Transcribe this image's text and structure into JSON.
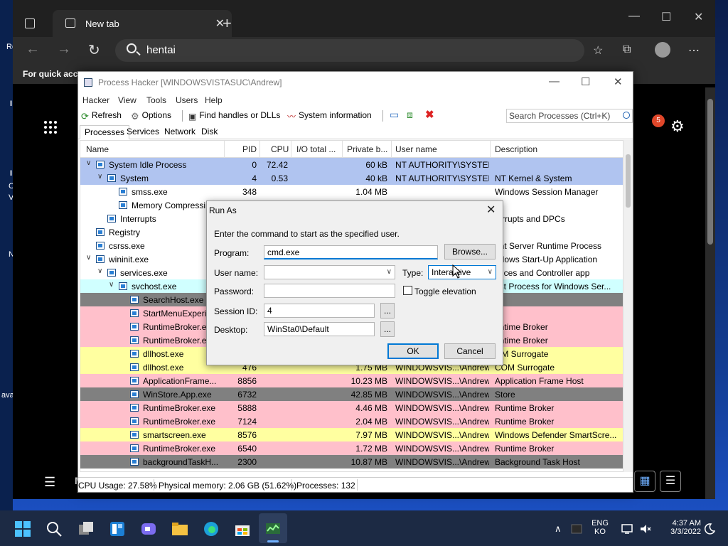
{
  "desktop": {
    "fragments": [
      "Re",
      "I",
      "I",
      "C",
      "V",
      "N",
      "ava"
    ]
  },
  "browser": {
    "tab_title": "New tab",
    "search_query": "hentai",
    "info_bar_text": "For quick acc",
    "notification_count": "5"
  },
  "ph": {
    "title": "Process Hacker [WINDOWSVISTASUC\\Andrew]",
    "menu": [
      "Hacker",
      "View",
      "Tools",
      "Users",
      "Help"
    ],
    "toolbar": {
      "refresh": "Refresh",
      "options": "Options",
      "find_handles": "Find handles or DLLs",
      "system_info": "System information",
      "search_placeholder": "Search Processes (Ctrl+K)"
    },
    "tabs": [
      "Processes",
      "Services",
      "Network",
      "Disk"
    ],
    "columns": [
      "Name",
      "PID",
      "CPU",
      "I/O total ...",
      "Private b...",
      "User name",
      "Description"
    ],
    "rows": [
      {
        "indent": 0,
        "twisty": "v",
        "name": "System Idle Process",
        "pid": "0",
        "cpu": "72.42",
        "io": "",
        "priv": "60 kB",
        "user": "NT AUTHORITY\\SYSTEM",
        "desc": "",
        "bg": "#b0c4f0"
      },
      {
        "indent": 1,
        "twisty": "v",
        "name": "System",
        "pid": "4",
        "cpu": "0.53",
        "io": "",
        "priv": "40 kB",
        "user": "NT AUTHORITY\\SYSTEM",
        "desc": "NT Kernel & System",
        "bg": "#b0c4f0"
      },
      {
        "indent": 2,
        "twisty": "",
        "name": "smss.exe",
        "pid": "348",
        "cpu": "",
        "io": "",
        "priv": "1.04 MB",
        "user": "",
        "desc": "Windows Session Manager",
        "bg": "#ffffff"
      },
      {
        "indent": 2,
        "twisty": "",
        "name": "Memory Compressi",
        "pid": "",
        "cpu": "",
        "io": "",
        "priv": "",
        "user": "",
        "desc": "",
        "bg": "#ffffff"
      },
      {
        "indent": 1,
        "twisty": "",
        "name": "Interrupts",
        "pid": "",
        "cpu": "",
        "io": "",
        "priv": "",
        "user": "",
        "desc": "terrupts and DPCs",
        "bg": "#ffffff"
      },
      {
        "indent": 0,
        "twisty": "",
        "name": "Registry",
        "pid": "",
        "cpu": "",
        "io": "",
        "priv": "",
        "user": "",
        "desc": "",
        "bg": "#ffffff"
      },
      {
        "indent": 0,
        "twisty": "",
        "name": "csrss.exe",
        "pid": "",
        "cpu": "",
        "io": "",
        "priv": "",
        "user": "",
        "desc": "ent Server Runtime Process",
        "bg": "#ffffff"
      },
      {
        "indent": 0,
        "twisty": "v",
        "name": "wininit.exe",
        "pid": "",
        "cpu": "",
        "io": "",
        "priv": "",
        "user": "",
        "desc": "ndows Start-Up Application",
        "bg": "#ffffff"
      },
      {
        "indent": 1,
        "twisty": "v",
        "name": "services.exe",
        "pid": "",
        "cpu": "",
        "io": "",
        "priv": "",
        "user": "",
        "desc": "rvices and Controller app",
        "bg": "#ffffff"
      },
      {
        "indent": 2,
        "twisty": "v",
        "name": "svchost.exe",
        "pid": "",
        "cpu": "",
        "io": "",
        "priv": "",
        "user": "",
        "desc": "ost Process for Windows Ser...",
        "bg": "#d0ffff"
      },
      {
        "indent": 3,
        "twisty": "",
        "name": "SearchHost.exe",
        "pid": "",
        "cpu": "",
        "io": "",
        "priv": "",
        "user": "",
        "desc": "",
        "bg": "#808080"
      },
      {
        "indent": 3,
        "twisty": "",
        "name": "StartMenuExperi",
        "pid": "",
        "cpu": "",
        "io": "",
        "priv": "",
        "user": "",
        "desc": "",
        "bg": "#ffc0cb"
      },
      {
        "indent": 3,
        "twisty": "",
        "name": "RuntimeBroker.e",
        "pid": "",
        "cpu": "",
        "io": "",
        "priv": "",
        "user": "",
        "desc": "untime Broker",
        "bg": "#ffc0cb"
      },
      {
        "indent": 3,
        "twisty": "",
        "name": "RuntimeBroker.e",
        "pid": "",
        "cpu": "",
        "io": "",
        "priv": "",
        "user": "",
        "desc": "untime Broker",
        "bg": "#ffc0cb"
      },
      {
        "indent": 3,
        "twisty": "",
        "name": "dllhost.exe",
        "pid": "",
        "cpu": "",
        "io": "",
        "priv": "",
        "user": "",
        "desc": "OM Surrogate",
        "bg": "#ffffa0"
      },
      {
        "indent": 3,
        "twisty": "",
        "name": "dllhost.exe",
        "pid": "476",
        "cpu": "",
        "io": "",
        "priv": "1.75 MB",
        "user": "WINDOWSVIS...\\Andrew",
        "desc": "COM Surrogate",
        "bg": "#ffffa0"
      },
      {
        "indent": 3,
        "twisty": "",
        "name": "ApplicationFrame...",
        "pid": "8856",
        "cpu": "",
        "io": "",
        "priv": "10.23 MB",
        "user": "WINDOWSVIS...\\Andrew",
        "desc": "Application Frame Host",
        "bg": "#ffc0cb"
      },
      {
        "indent": 3,
        "twisty": "",
        "name": "WinStore.App.exe",
        "pid": "6732",
        "cpu": "",
        "io": "",
        "priv": "42.85 MB",
        "user": "WINDOWSVIS...\\Andrew",
        "desc": "Store",
        "bg": "#808080"
      },
      {
        "indent": 3,
        "twisty": "",
        "name": "RuntimeBroker.exe",
        "pid": "5888",
        "cpu": "",
        "io": "",
        "priv": "4.46 MB",
        "user": "WINDOWSVIS...\\Andrew",
        "desc": "Runtime Broker",
        "bg": "#ffc0cb"
      },
      {
        "indent": 3,
        "twisty": "",
        "name": "RuntimeBroker.exe",
        "pid": "7124",
        "cpu": "",
        "io": "",
        "priv": "2.04 MB",
        "user": "WINDOWSVIS...\\Andrew",
        "desc": "Runtime Broker",
        "bg": "#ffc0cb"
      },
      {
        "indent": 3,
        "twisty": "",
        "name": "smartscreen.exe",
        "pid": "8576",
        "cpu": "",
        "io": "",
        "priv": "7.97 MB",
        "user": "WINDOWSVIS...\\Andrew",
        "desc": "Windows Defender SmartScre...",
        "bg": "#ffffa0"
      },
      {
        "indent": 3,
        "twisty": "",
        "name": "RuntimeBroker.exe",
        "pid": "6540",
        "cpu": "",
        "io": "",
        "priv": "1.72 MB",
        "user": "WINDOWSVIS...\\Andrew",
        "desc": "Runtime Broker",
        "bg": "#ffc0cb"
      },
      {
        "indent": 3,
        "twisty": "",
        "name": "backgroundTaskH...",
        "pid": "2300",
        "cpu": "",
        "io": "",
        "priv": "10.87 MB",
        "user": "WINDOWSVIS...\\Andrew",
        "desc": "Background Task Host",
        "bg": "#808080"
      }
    ],
    "status": {
      "cpu": "CPU Usage: 27.58%",
      "memory": "Physical memory: 2.06 GB (51.62%)",
      "processes": "Processes: 132"
    }
  },
  "run_as": {
    "title": "Run As",
    "instruction": "Enter the command to start as the specified user.",
    "program_label": "Program:",
    "program_value": "cmd.exe",
    "browse_label": "Browse...",
    "username_label": "User name:",
    "username_value": "",
    "type_label": "Type:",
    "type_value": "Interactive",
    "password_label": "Password:",
    "toggle_elevation_label": "Toggle elevation",
    "session_label": "Session ID:",
    "session_value": "4",
    "desktop_label": "Desktop:",
    "desktop_value": "WinSta0\\Default",
    "ellipsis": "...",
    "ok_label": "OK",
    "cancel_label": "Cancel"
  },
  "taskbar": {
    "lang_top": "ENG",
    "lang_bottom": "KO",
    "time": "4:37 AM",
    "date": "3/3/2022"
  }
}
